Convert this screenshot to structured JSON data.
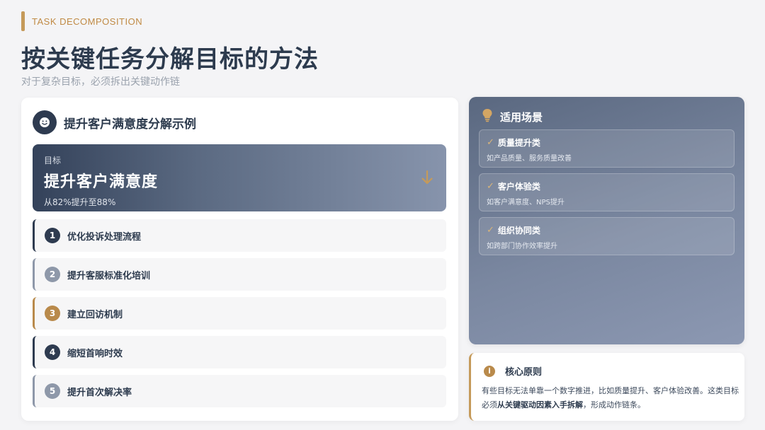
{
  "header": {
    "tag": "TASK DECOMPOSITION",
    "title": "按关键任务分解目标的方法",
    "subtitle": "对于复杂目标，必须拆出关键动作链"
  },
  "example": {
    "title": "提升客户满意度分解示例",
    "goal": {
      "label": "目标",
      "name": "提升客户满意度",
      "detail": "从82%提升至88%"
    },
    "steps": [
      {
        "num": "1",
        "label": "优化投诉处理流程",
        "color": "#2e3b50"
      },
      {
        "num": "2",
        "label": "提升客服标准化培训",
        "color": "#8e98a9"
      },
      {
        "num": "3",
        "label": "建立回访机制",
        "color": "#b98a4b"
      },
      {
        "num": "4",
        "label": "缩短首响时效",
        "color": "#2e3b50"
      },
      {
        "num": "5",
        "label": "提升首次解决率",
        "color": "#8e98a9"
      }
    ]
  },
  "scenarios": {
    "title": "适用场景",
    "items": [
      {
        "title": "质量提升类",
        "desc": "如产品质量、服务质量改善"
      },
      {
        "title": "客户体验类",
        "desc": "如客户满意度、NPS提升"
      },
      {
        "title": "组织协同类",
        "desc": "如跨部门协作效率提升"
      }
    ]
  },
  "principle": {
    "title": "核心原则",
    "text_before": "有些目标无法单靠一个数字推进，比如质量提升、客户体验改善。这类目标必须",
    "text_bold": "从关键驱动因素入手拆解",
    "text_after": "，形成动作链条。"
  },
  "colors": {
    "accent": "#c59a5a",
    "primary": "#2e3b50"
  }
}
